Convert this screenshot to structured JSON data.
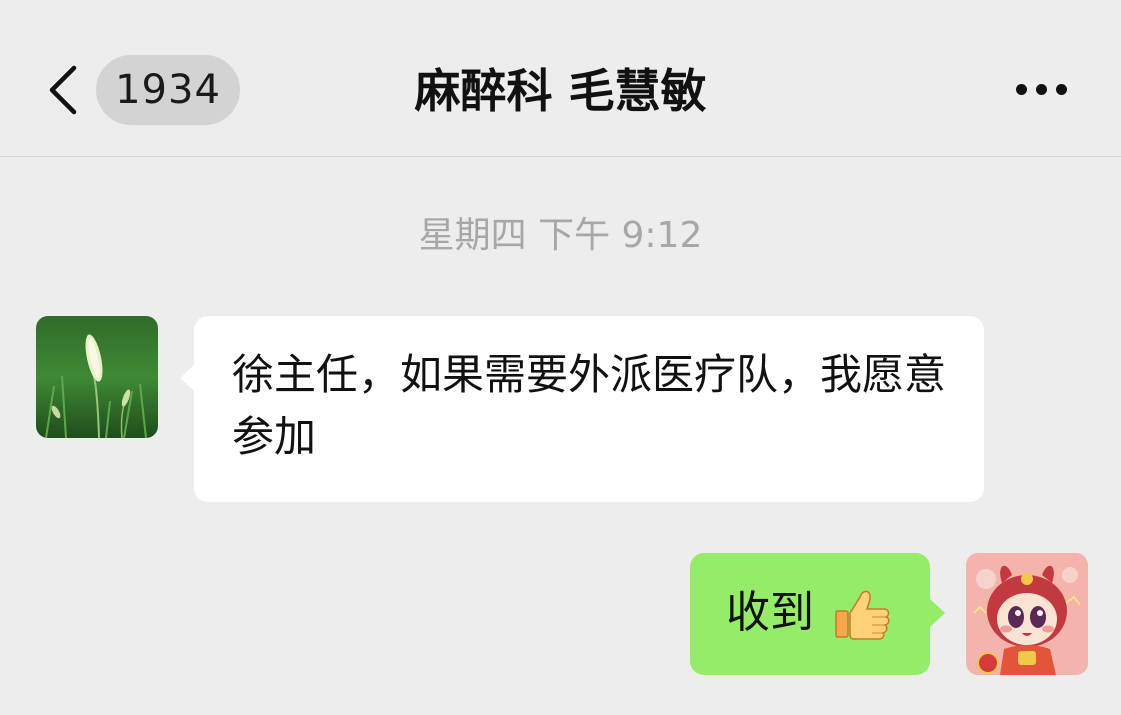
{
  "header": {
    "back_label": "1934",
    "title": "麻醉科 毛慧敏"
  },
  "messages": [
    {
      "side": "left",
      "text": "徐主任，如果需要外派医疗队，我愿意参加"
    },
    {
      "side": "right",
      "text": "收到",
      "emoji": "thumbs-up-icon"
    }
  ],
  "timestamp": "星期四 下午 9:12",
  "colors": {
    "background": "#ededed",
    "incoming_bubble": "#ffffff",
    "outgoing_bubble": "#95ec69",
    "timestamp_text": "#a7a7a7"
  }
}
